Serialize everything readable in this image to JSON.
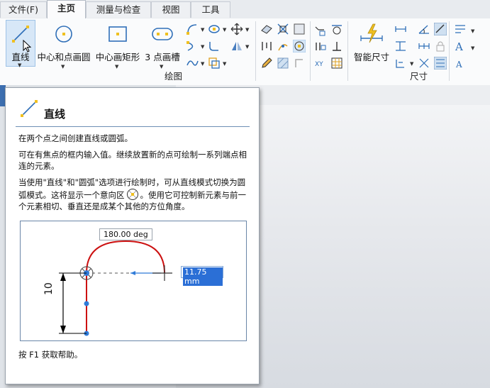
{
  "tabs": [
    {
      "label": "文件(F)"
    },
    {
      "label": "主页"
    },
    {
      "label": "测量与检查"
    },
    {
      "label": "视图"
    },
    {
      "label": "工具"
    }
  ],
  "ribbon": {
    "draw_group_label": "绘图",
    "dimension_group_label": "尺寸",
    "buttons": {
      "line": "直线",
      "center_circle": "中心和点画圆",
      "center_rect": "中心画矩形",
      "three_point_slot": "3 点画槽",
      "smart_dimension": "智能尺寸"
    }
  },
  "tooltip": {
    "title": "直线",
    "para1": "在两个点之间创建直线或圆弧。",
    "para2": "可在有焦点的框内输入值。继续放置新的点可绘制一系列端点相连的元素。",
    "para3a": "当使用\"直线\"和\"圆弧\"选项进行绘制时，可从直线模式切换为圆弧模式。这将显示一个意向区",
    "para3b": "。使用它可控制新元素与前一个元素相切、垂直还是成某个其他的方位角度。",
    "figure": {
      "angle_label": "180.00 deg",
      "length_input": "11.75 mm",
      "dim_label": "10"
    },
    "help": "按 F1 获取帮助。"
  },
  "colors": {
    "accent": "#3d6fb0",
    "arc_red": "#cc1111",
    "point_blue": "#2f7bd8",
    "selection_bg": "#2b6fd6"
  }
}
